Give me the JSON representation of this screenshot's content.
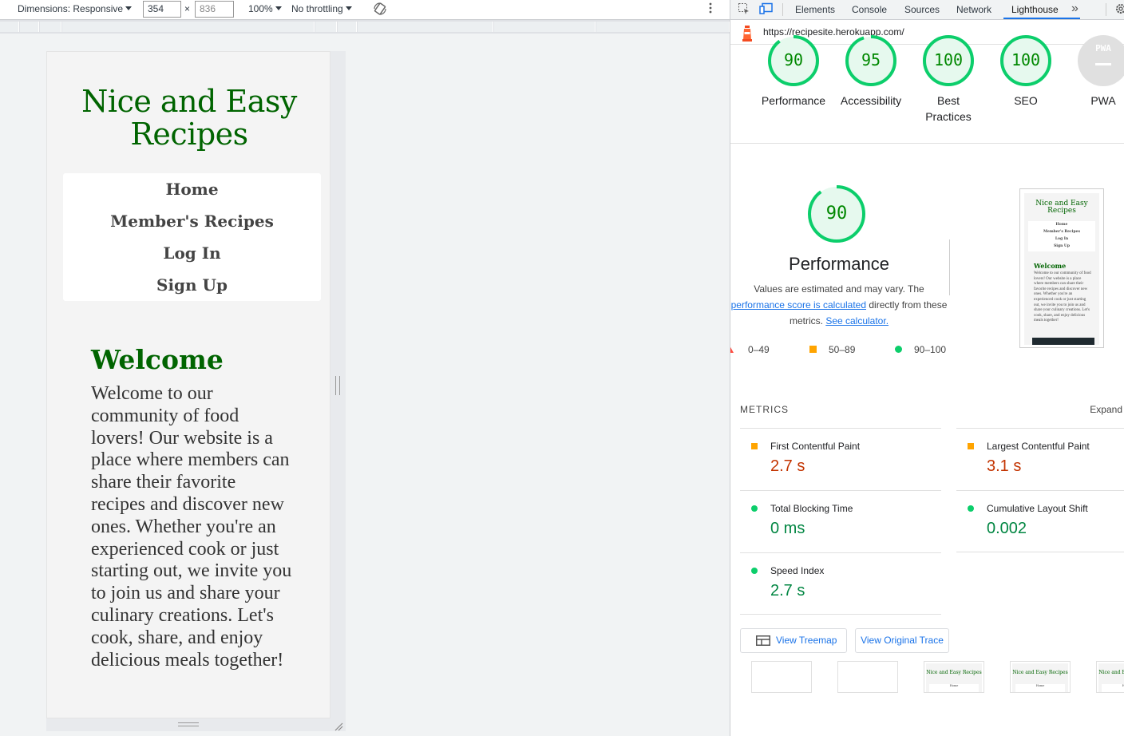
{
  "device_toolbar": {
    "dimensions_label": "Dimensions: Responsive",
    "width": "354",
    "times": "×",
    "height": "836",
    "zoom": "100%",
    "throttling": "No throttling"
  },
  "site": {
    "title": "Nice and Easy Recipes",
    "nav": [
      "Home",
      "Member's Recipes",
      "Log In",
      "Sign Up"
    ],
    "welcome_heading": "Welcome",
    "welcome_text": "Welcome to our community of food lovers! Our website is a place where members can share their favorite recipes and discover new ones. Whether you're an experienced cook or just starting out, we invite you to join us and share your culinary creations. Let's cook, share, and enjoy delicious meals together!"
  },
  "devtools": {
    "tabs": [
      "Elements",
      "Console",
      "Sources",
      "Network",
      "Lighthouse"
    ],
    "active_tab": "Lighthouse",
    "more_tabs": "»",
    "url": "https://recipesite.herokuapp.com/"
  },
  "scores": [
    {
      "value": "90",
      "label": "Performance",
      "fraction": 0.9
    },
    {
      "value": "95",
      "label": "Accessibility",
      "fraction": 0.95
    },
    {
      "value": "100",
      "label": "Best Practices",
      "fraction": 1.0
    },
    {
      "value": "100",
      "label": "SEO",
      "fraction": 1.0
    },
    {
      "value": "PWA",
      "label": "PWA",
      "fraction": 0
    }
  ],
  "performance": {
    "score": "90",
    "title": "Performance",
    "desc_1": "Values are estimated and may vary. The",
    "desc_link": "performance score is calculated",
    "desc_2": "directly from these metrics.",
    "calc_link": "See calculator.",
    "legend": [
      "0–49",
      "50–89",
      "90–100"
    ]
  },
  "metrics": {
    "label": "METRICS",
    "expand": "Expand",
    "items": [
      {
        "name": "First Contentful Paint",
        "value": "2.7 s",
        "status": "average"
      },
      {
        "name": "Largest Contentful Paint",
        "value": "3.1 s",
        "status": "average"
      },
      {
        "name": "Total Blocking Time",
        "value": "0 ms",
        "status": "pass"
      },
      {
        "name": "Cumulative Layout Shift",
        "value": "0.002",
        "status": "pass"
      },
      {
        "name": "Speed Index",
        "value": "2.7 s",
        "status": "pass"
      }
    ]
  },
  "buttons": {
    "treemap": "View Treemap",
    "trace": "View Original Trace"
  },
  "thumbnail": {
    "title": "Nice and Easy Recipes",
    "nav": [
      "Home",
      "Member's Recipes",
      "Log In",
      "Sign Up"
    ],
    "welcome": "Welcome",
    "text": "Welcome to our community of food lovers! Our website is a place where members can share their favorite recipes and discover new ones. Whether you're an experienced cook or just starting out, we invite you to join us and share your culinary creations. Let's cook, share, and enjoy delicious meals together!"
  },
  "filmstrip": {
    "title": "Nice and Easy Recipes",
    "nav": "Home"
  },
  "colors": {
    "pass": "#0cce6b",
    "average": "#ffa400",
    "fail": "#ff4e42",
    "site_green": "#006400",
    "link": "#1a73e8"
  }
}
